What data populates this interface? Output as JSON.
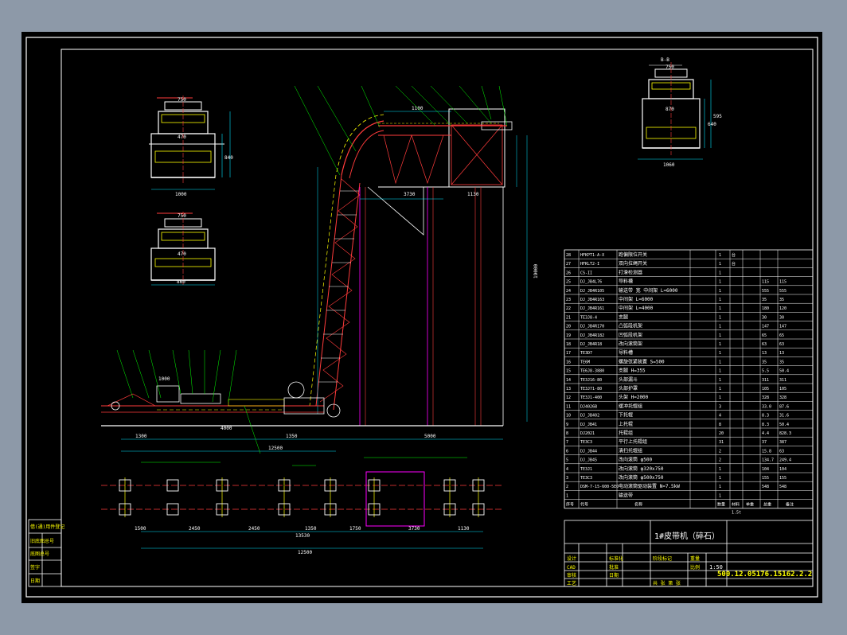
{
  "drawing": {
    "title": "1#皮带机（碎石）",
    "drawing_number": "500.12.05176.15162.2.2",
    "scale": "1:50",
    "colors": {
      "background": "#000000",
      "frame": "#ffffff",
      "belt": "#ff3b3b",
      "structure": "#ffff00",
      "dimension": "#00e5ff",
      "leader": "#00ff00",
      "highlight": "#ff00ff"
    }
  },
  "views": {
    "section_top_left": {
      "w1": "750",
      "w2": "470",
      "w3": "1000",
      "w4": "840"
    },
    "section_mid_left": {
      "w1": "750",
      "w2": "470",
      "w3": "860"
    },
    "section_right": {
      "label": "B-B",
      "w1": "750",
      "w2": "870",
      "w3": "1060",
      "h1": "640",
      "h2": "595"
    }
  },
  "dimensions": {
    "top_1100": "1100",
    "d_3730": "3730",
    "d_1130": "1130",
    "d_12500": "12500",
    "d_5000": "5000",
    "d_4000": "4000",
    "d_1350": "1350",
    "d_1300": "1300",
    "d_1000": "1000",
    "plan_1500": "1500",
    "plan_2450a": "2450",
    "plan_2450b": "2450",
    "plan_1350": "1350",
    "plan_1750": "1750",
    "plan_3730": "3730",
    "plan_1130": "1130",
    "plan_12500": "12500",
    "plan_total": "13530",
    "height_19000": "19000"
  },
  "parts_table": {
    "rows": [
      {
        "no": "28",
        "code": "HFKPT1-A-X",
        "name": "跑偏限位开关",
        "qty": "1",
        "unit": "台",
        "w1": "",
        "w2": ""
      },
      {
        "no": "27",
        "code": "HFKLT2-I",
        "name": "双向拉绳开关",
        "qty": "1",
        "unit": "台",
        "w1": "",
        "w2": ""
      },
      {
        "no": "26",
        "code": "CS-II",
        "name": "打滑检测器",
        "qty": "1",
        "unit": "",
        "w1": "",
        "w2": ""
      },
      {
        "no": "25",
        "code": "DJ_JB4L76",
        "name": "导料槽",
        "qty": "1",
        "unit": "",
        "w1": "115",
        "w2": "115"
      },
      {
        "no": "24",
        "code": "DJ_JB4R105",
        "name": "输送带 宽 中间架 L=6000",
        "qty": "1",
        "unit": "",
        "w1": "555",
        "w2": "555"
      },
      {
        "no": "23",
        "code": "DJ_JB4R163",
        "name": "中间架 L=6000",
        "qty": "1",
        "unit": "",
        "w1": "35",
        "w2": "35"
      },
      {
        "no": "22",
        "code": "DJ_JB4R161",
        "name": "中间架 L=4000",
        "qty": "1",
        "unit": "",
        "w1": "180",
        "w2": "120"
      },
      {
        "no": "21",
        "code": "TE3J8-4",
        "name": "支腿",
        "qty": "1",
        "unit": "",
        "w1": "30",
        "w2": "30"
      },
      {
        "no": "20",
        "code": "DJ_JB4R170",
        "name": "凸弧段机架",
        "qty": "1",
        "unit": "",
        "w1": "147",
        "w2": "147"
      },
      {
        "no": "19",
        "code": "DJ_JB4R182",
        "name": "凹弧段机架",
        "qty": "1",
        "unit": "",
        "w1": "65",
        "w2": "65"
      },
      {
        "no": "18",
        "code": "DJ_JB4R18",
        "name": "改向滚筒架",
        "qty": "1",
        "unit": "",
        "w1": "63",
        "w2": "63"
      },
      {
        "no": "17",
        "code": "TE3D7",
        "name": "导料槽",
        "qty": "1",
        "unit": "",
        "w1": "13",
        "w2": "13"
      },
      {
        "no": "16",
        "code": "TE6M",
        "name": "螺旋张紧装置 S=500",
        "qty": "1",
        "unit": "",
        "w1": "35",
        "w2": "35"
      },
      {
        "no": "15",
        "code": "TE6J8-3880",
        "name": "支腿 H=355",
        "qty": "1",
        "unit": "",
        "w1": "5.5",
        "w2": "50.4"
      },
      {
        "no": "14",
        "code": "TE3J16-80",
        "name": "头部漏斗",
        "qty": "1",
        "unit": "",
        "w1": "311",
        "w2": "311"
      },
      {
        "no": "13",
        "code": "TE3J71-80",
        "name": "头部护罩",
        "qty": "1",
        "unit": "",
        "w1": "105",
        "w2": "105"
      },
      {
        "no": "12",
        "code": "TE3J1-400",
        "name": "头架 H=2000",
        "qty": "1",
        "unit": "",
        "w1": "328",
        "w2": "328"
      },
      {
        "no": "11",
        "code": "DJ4026B",
        "name": "缓冲托辊组",
        "qty": "3",
        "unit": "",
        "w1": "33.0",
        "w2": "87.6"
      },
      {
        "no": "10",
        "code": "DJ_JB402",
        "name": "下托辊",
        "qty": "4",
        "unit": "",
        "w1": "8.3",
        "w2": "31.6"
      },
      {
        "no": "9",
        "code": "DJ_JB41",
        "name": "上托辊",
        "qty": "8",
        "unit": "",
        "w1": "8.3",
        "w2": "50.4"
      },
      {
        "no": "8",
        "code": "DJ2021",
        "name": "托辊组",
        "qty": "20",
        "unit": "",
        "w1": "4.4",
        "w2": "828.3"
      },
      {
        "no": "7",
        "code": "TE3C3",
        "name": "平行上托辊组",
        "qty": "31",
        "unit": "",
        "w1": "37",
        "w2": "387"
      },
      {
        "no": "6",
        "code": "DJ_JB44",
        "name": "清扫托辊组",
        "qty": "2",
        "unit": "",
        "w1": "15.8",
        "w2": "63"
      },
      {
        "no": "5",
        "code": "DJ_JB45",
        "name": "改向滚筒 φ500",
        "qty": "2",
        "unit": "",
        "w1": "134.7",
        "w2": "249.4"
      },
      {
        "no": "4",
        "code": "TE3J1",
        "name": "改向滚筒 φ320x750",
        "qty": "1",
        "unit": "",
        "w1": "104",
        "w2": "104"
      },
      {
        "no": "3",
        "code": "TE3C3",
        "name": "改向滚筒 φ500x750",
        "qty": "1",
        "unit": "",
        "w1": "155",
        "w2": "155"
      },
      {
        "no": "2",
        "code": "DSM-7-15-600-5EO",
        "name": "电动滚筒驱动装置 N=7.5kW",
        "qty": "1",
        "unit": "",
        "w1": "548",
        "w2": "548"
      },
      {
        "no": "1",
        "code": "",
        "name": "输送带",
        "qty": "1",
        "unit": "",
        "w1": "",
        "w2": ""
      }
    ],
    "header": [
      "序号",
      "代号",
      "名称",
      "数量",
      "材料",
      "单重",
      "总重",
      "备注"
    ],
    "total_label": "1.5t"
  },
  "title_block": {
    "scale_label": "比例",
    "rows_left": [
      "设计",
      "CAD",
      "审核",
      "工艺"
    ],
    "rows_mid": [
      "标准化",
      "批准",
      "日期"
    ],
    "stage": "阶段标记",
    "weight": "重量",
    "sheet": "共 张 第 张"
  },
  "left_stamp": {
    "rows": [
      "借(通)用件登记",
      "旧底图总号",
      "底图总号",
      "签字",
      "日期"
    ]
  }
}
